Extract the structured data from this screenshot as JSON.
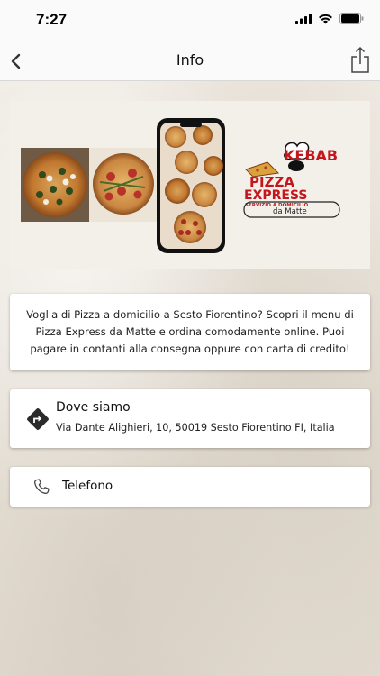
{
  "status_bar": {
    "time": "7:27"
  },
  "nav": {
    "title": "Info",
    "back_icon": "chevron-left-icon",
    "share_icon": "share-icon"
  },
  "banner": {
    "logo_top": "KEBAB",
    "logo_main_1": "PIZZA",
    "logo_main_2": "EXPRESS",
    "logo_tagline": "SERVIZIO A DOMICILIO",
    "logo_sub": "da Matte"
  },
  "intro": {
    "text": "Voglia di Pizza a domicilio a Sesto Fiorentino? Scopri il menu di Pizza Express da Matte e ordina comodamente online. Puoi pagare in contanti alla consegna oppure con carta di credito!"
  },
  "address": {
    "title": "Dove siamo",
    "value": "Via Dante Alighieri, 10, 50019 Sesto Fiorentino FI, Italia",
    "icon": "directions-icon"
  },
  "phone": {
    "label": "Telefono",
    "icon": "phone-icon"
  },
  "colors": {
    "logo_red": "#c4161c",
    "nav_bg": "#fafafa",
    "card_bg": "#ffffff"
  }
}
